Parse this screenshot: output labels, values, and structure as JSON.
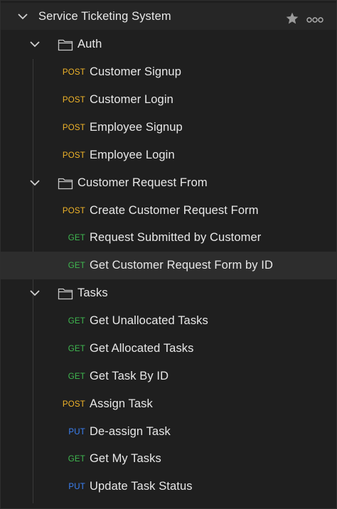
{
  "collection": {
    "name": "Service Ticketing System",
    "icons": {
      "favorite": "star-icon",
      "more": "more-options-icon",
      "expand": "chevron-down-icon"
    }
  },
  "folders": [
    {
      "name": "Auth",
      "requests": [
        {
          "method": "POST",
          "name": "Customer Signup"
        },
        {
          "method": "POST",
          "name": "Customer Login"
        },
        {
          "method": "POST",
          "name": "Employee Signup"
        },
        {
          "method": "POST",
          "name": "Employee Login"
        }
      ]
    },
    {
      "name": "Customer Request From",
      "requests": [
        {
          "method": "POST",
          "name": "Create Customer Request Form"
        },
        {
          "method": "GET",
          "name": "Request Submitted by Customer"
        },
        {
          "method": "GET",
          "name": "Get Customer Request Form by ID"
        }
      ]
    },
    {
      "name": "Tasks",
      "requests": [
        {
          "method": "GET",
          "name": "Get Unallocated Tasks"
        },
        {
          "method": "GET",
          "name": "Get Allocated Tasks"
        },
        {
          "method": "GET",
          "name": "Get Task By ID"
        },
        {
          "method": "POST",
          "name": "Assign Task"
        },
        {
          "method": "PUT",
          "name": "De-assign Task"
        },
        {
          "method": "GET",
          "name": "Get My Tasks"
        },
        {
          "method": "PUT",
          "name": "Update Task Status"
        }
      ]
    }
  ],
  "colors": {
    "post": "#f0b429",
    "get": "#3fb950",
    "put": "#3b82f6",
    "background": "#1f1f1f",
    "selected_row": "#2d2d2d"
  }
}
